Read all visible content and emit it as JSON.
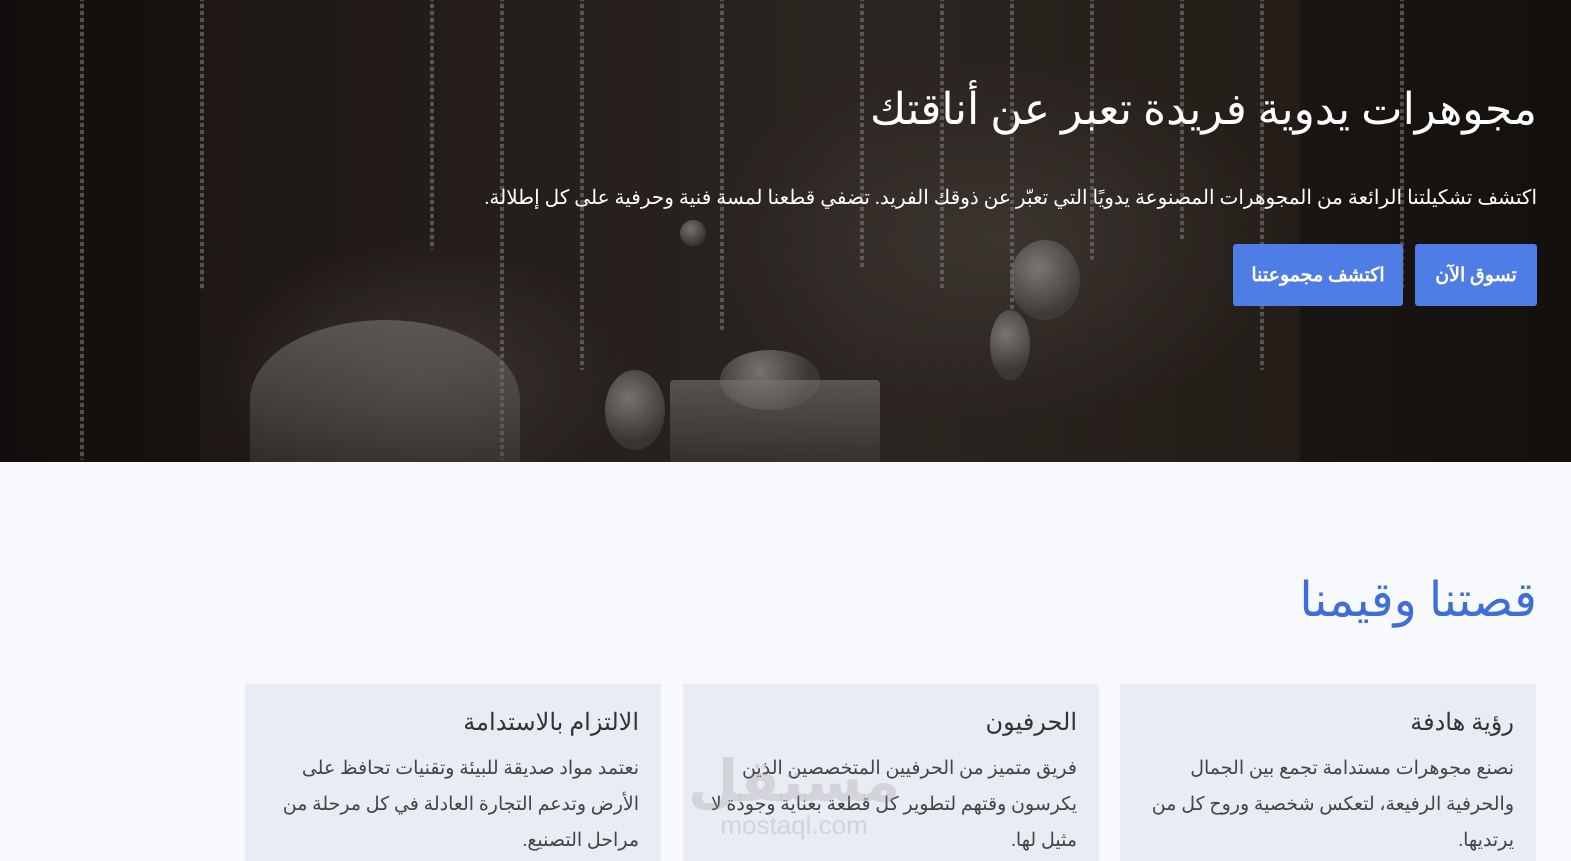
{
  "hero": {
    "title": "مجوهرات يدوية فريدة تعبر عن أناقتك",
    "subtitle": "اكتشف تشكيلتنا الرائعة من المجوهرات المصنوعة يدويًا التي تعبّر عن ذوقك الفريد. تضفي قطعنا لمسة فنية وحرفية على كل إطلالة.",
    "shop_button": "تسوق الآن",
    "explore_button": "اكتشف مجموعتنا"
  },
  "story": {
    "title": "قصتنا وقيمنا",
    "cards": [
      {
        "title": "رؤية هادفة",
        "text": "نصنع مجوهرات مستدامة تجمع بين الجمال والحرفية الرفيعة، لتعكس شخصية وروح كل من يرتديها."
      },
      {
        "title": "الحرفيون",
        "text": "فريق متميز من الحرفيين المتخصصين الذين يكرسون وقتهم لتطوير كل قطعة بعناية وجودة لا مثيل لها."
      },
      {
        "title": "الالتزام بالاستدامة",
        "text": "نعتمد مواد صديقة للبيئة وتقنيات تحافظ على الأرض وتدعم التجارة العادلة في كل مرحلة من مراحل التصنيع."
      }
    ]
  },
  "watermark": {
    "arabic": "مستقل",
    "latin": "mostaql.com"
  },
  "colors": {
    "accent": "#4f7de6",
    "heading": "#3d6fd4",
    "card_bg": "#e9ecf4",
    "page_bg": "#f8f9fc"
  }
}
